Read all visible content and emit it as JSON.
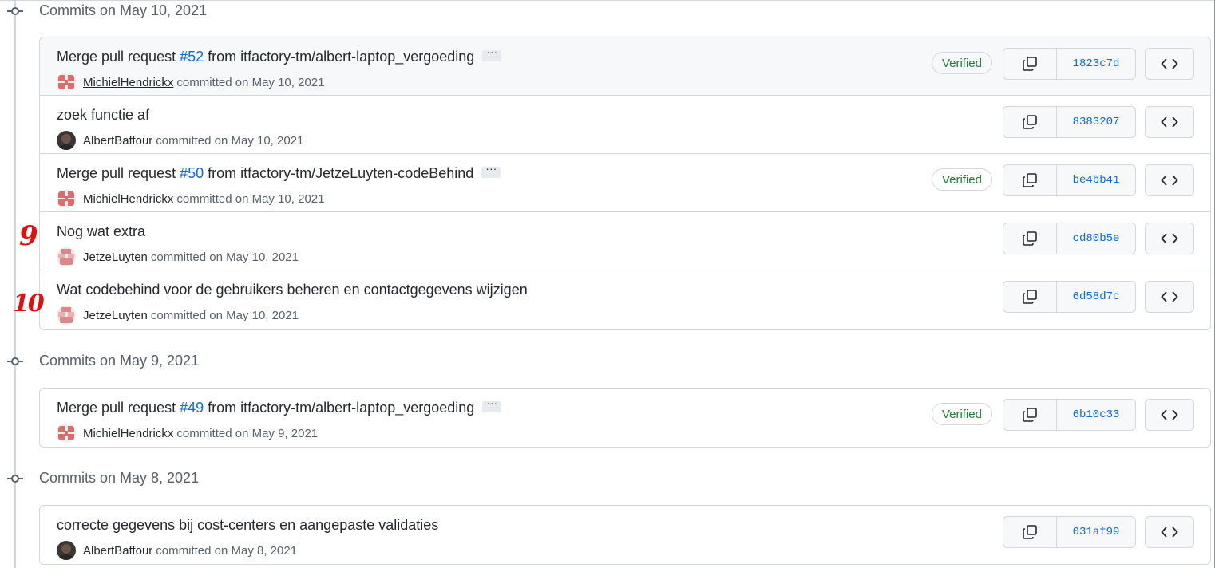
{
  "groups": [
    {
      "title": "Commits on May 10, 2021",
      "commits": [
        {
          "message_pre": "Merge pull request ",
          "pr": "#52",
          "message_post": " from itfactory-tm/albert-laptop_vergoeding",
          "author": "MichielHendrickx",
          "committed": "committed on May 10, 2021",
          "verified": "Verified",
          "sha": "1823c7d"
        },
        {
          "message": "zoek functie af",
          "author": "AlbertBaffour",
          "committed": "committed on May 10, 2021",
          "sha": "8383207"
        },
        {
          "message_pre": "Merge pull request ",
          "pr": "#50",
          "message_post": " from itfactory-tm/JetzeLuyten-codeBehind",
          "author": "MichielHendrickx",
          "committed": "committed on May 10, 2021",
          "verified": "Verified",
          "sha": "be4bb41"
        },
        {
          "message": "Nog wat extra",
          "author": "JetzeLuyten",
          "committed": "committed on May 10, 2021",
          "sha": "cd80b5e"
        },
        {
          "message": "Wat codebehind voor de gebruikers beheren en contactgegevens wijzigen",
          "author": "JetzeLuyten",
          "committed": "committed on May 10, 2021",
          "sha": "6d58d7c"
        }
      ]
    },
    {
      "title": "Commits on May 9, 2021",
      "commits": [
        {
          "message_pre": "Merge pull request ",
          "pr": "#49",
          "message_post": " from itfactory-tm/albert-laptop_vergoeding",
          "author": "MichielHendrickx",
          "committed": "committed on May 9, 2021",
          "verified": "Verified",
          "sha": "6b10c33"
        }
      ]
    },
    {
      "title": "Commits on May 8, 2021",
      "commits": [
        {
          "message": "correcte gegevens bij cost-centers en aangepaste validaties",
          "author": "AlbertBaffour",
          "committed": "committed on May 8, 2021",
          "sha": "031af99"
        }
      ]
    }
  ],
  "annotations": [
    "9",
    "10"
  ],
  "icons": {
    "commit_node": "git-commit-icon",
    "copy": "copy-icon",
    "browse": "code-icon",
    "ellipsis": "ellipsis-icon"
  },
  "colors": {
    "link": "#0969da",
    "verified": "#1a7f37",
    "annotation": "#e01010"
  }
}
